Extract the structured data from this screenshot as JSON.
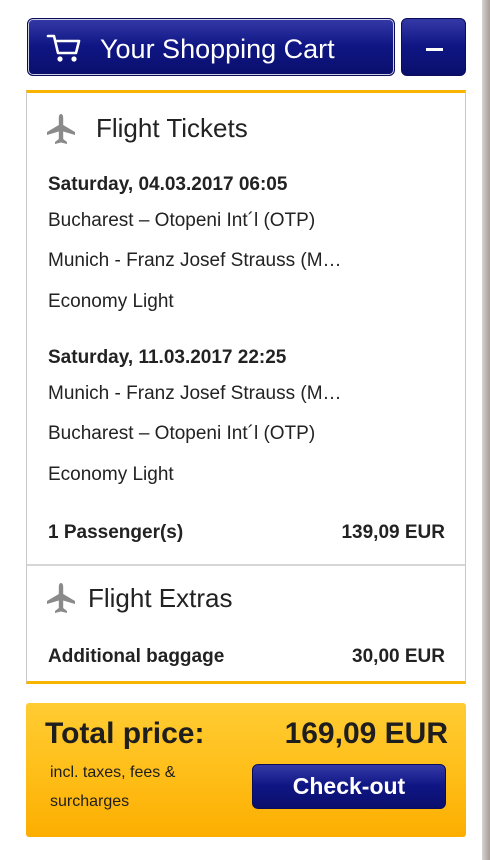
{
  "header": {
    "cart_title": "Your Shopping Cart",
    "cart_icon": "shopping-cart-icon",
    "collapse_symbol": "minus"
  },
  "flight_tickets": {
    "title": "Flight Tickets",
    "icon": "airplane-icon",
    "flights": [
      {
        "date_time": "Saturday, 04.03.2017 06:05",
        "from": "Bucharest – Otopeni Int´l (OTP)",
        "to": "Munich - Franz Josef Strauss (M…",
        "fare": "Economy Light"
      },
      {
        "date_time": "Saturday, 11.03.2017 22:25",
        "from": "Munich - Franz Josef Strauss (M…",
        "to": "Bucharest – Otopeni Int´l (OTP)",
        "fare": "Economy Light"
      }
    ],
    "passengers_label": "1 Passenger(s)",
    "passengers_price": "139,09 EUR"
  },
  "flight_extras": {
    "title": "Flight Extras",
    "icon": "airplane-icon",
    "items": [
      {
        "label": "Additional baggage",
        "price": "30,00 EUR"
      }
    ]
  },
  "total": {
    "label": "Total price:",
    "amount": "169,09 EUR",
    "note": "incl. taxes, fees & surcharges",
    "checkout_label": "Check-out"
  },
  "colors": {
    "navy": "#0f1684",
    "accent_yellow": "#ffbf1a",
    "divider": "#d6d6d6"
  }
}
